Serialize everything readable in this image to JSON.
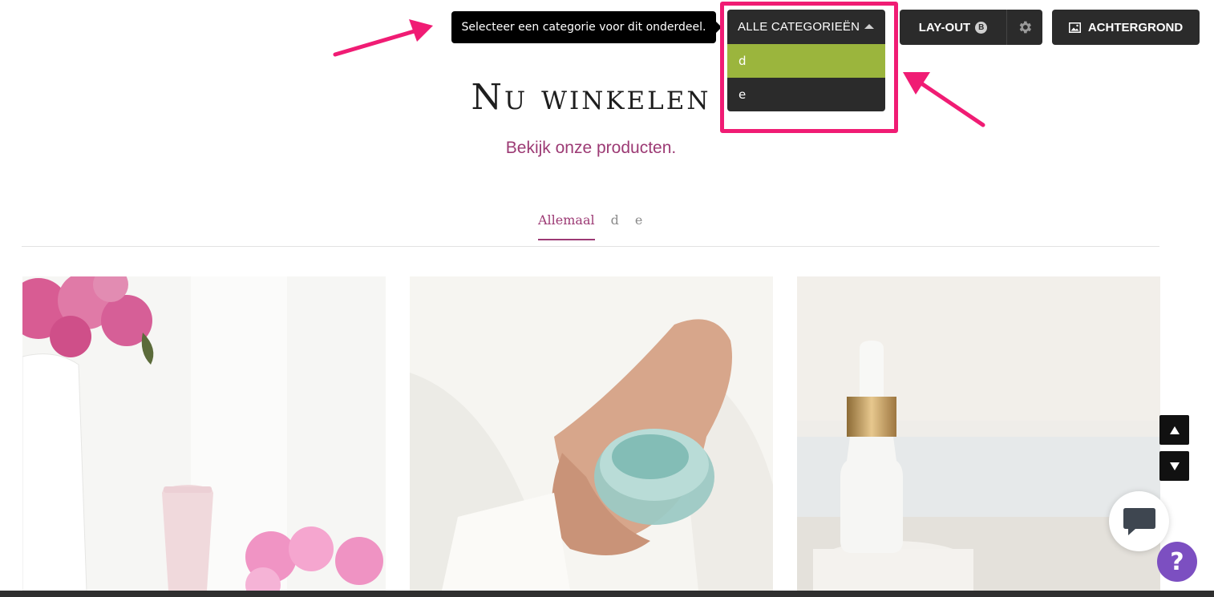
{
  "toolbar": {
    "tooltip_text": "Selecteer een categorie voor dit onderdeel.",
    "category_select": {
      "label": "ALLE CATEGORIEËN",
      "options": [
        "d",
        "e"
      ],
      "highlighted_option": "d"
    },
    "layout_label": "LAY-OUT",
    "layout_badge": "B",
    "settings_icon": "gear-icon",
    "background_label": "ACHTERGROND",
    "background_icon": "image-icon"
  },
  "section": {
    "title": "Nu winkelen",
    "subtitle": "Bekijk onze producten."
  },
  "tabs": [
    "Allemaal",
    "d",
    "e"
  ],
  "active_tab": "Allemaal",
  "colors": {
    "accent": "#9c3a74",
    "highlight": "#f01c74",
    "dropdown_active": "#9bb53d",
    "help": "#7c4fc1"
  },
  "products": [
    {
      "image": "pink-tube-with-peonies"
    },
    {
      "image": "hands-holding-gel-jar"
    },
    {
      "image": "dropper-bottle-on-stone"
    }
  ],
  "floating": {
    "help_label": "?"
  }
}
